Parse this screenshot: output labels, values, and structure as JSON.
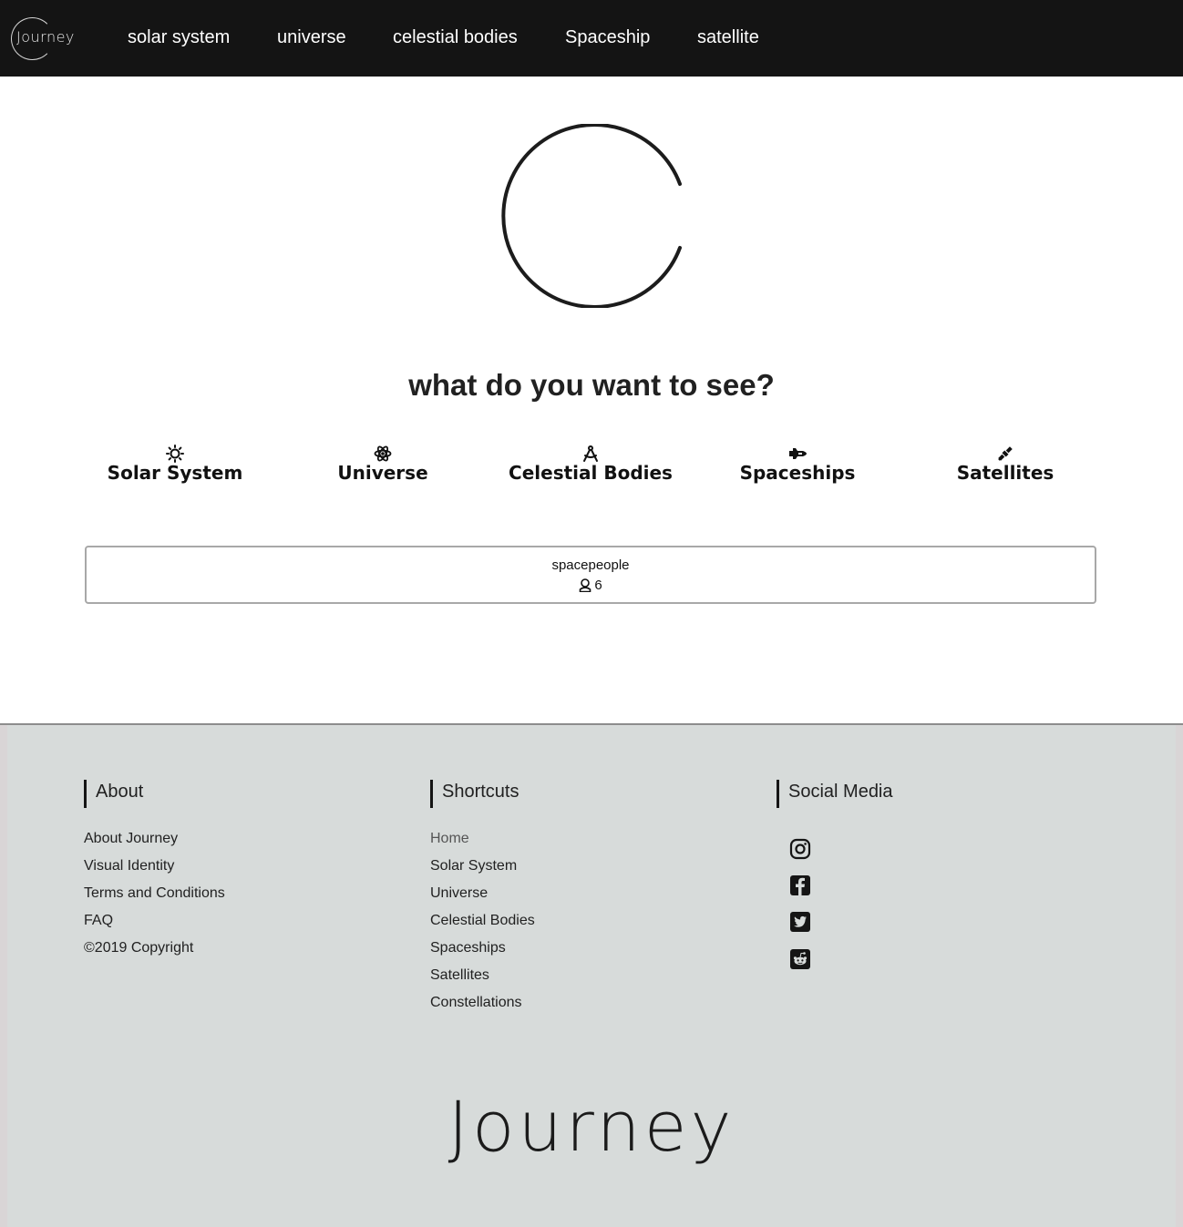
{
  "nav": {
    "logo_text": "Journey",
    "links": [
      "solar system",
      "universe",
      "celestial bodies",
      "Spaceship",
      "satellite"
    ]
  },
  "hero": {
    "title": "what do you want to see?"
  },
  "categories": [
    {
      "label": "Solar System",
      "icon": "sun-icon"
    },
    {
      "label": "Universe",
      "icon": "atom-icon"
    },
    {
      "label": "Celestial Bodies",
      "icon": "compass-icon"
    },
    {
      "label": "Spaceships",
      "icon": "shuttle-icon"
    },
    {
      "label": "Satellites",
      "icon": "satellite-icon"
    }
  ],
  "card": {
    "title": "spacepeople",
    "count": "6",
    "count_icon": "astronaut-icon"
  },
  "footer": {
    "about": {
      "heading": "About",
      "links": [
        "About Journey",
        "Visual Identity",
        "Terms and Conditions",
        "FAQ",
        "©2019 Copyright"
      ]
    },
    "shortcuts": {
      "heading": "Shortcuts",
      "links": [
        "Home",
        "Solar System",
        "Universe",
        "Celestial Bodies",
        "Spaceships",
        "Satellites",
        "Constellations"
      ]
    },
    "social": {
      "heading": "Social Media",
      "icons": [
        "instagram-icon",
        "facebook-icon",
        "twitter-icon",
        "reddit-icon"
      ]
    },
    "logo_text": "Journey"
  },
  "colors": {
    "nav_bg": "#141414",
    "footer_bg": "#d7dbda",
    "text": "#212121"
  }
}
